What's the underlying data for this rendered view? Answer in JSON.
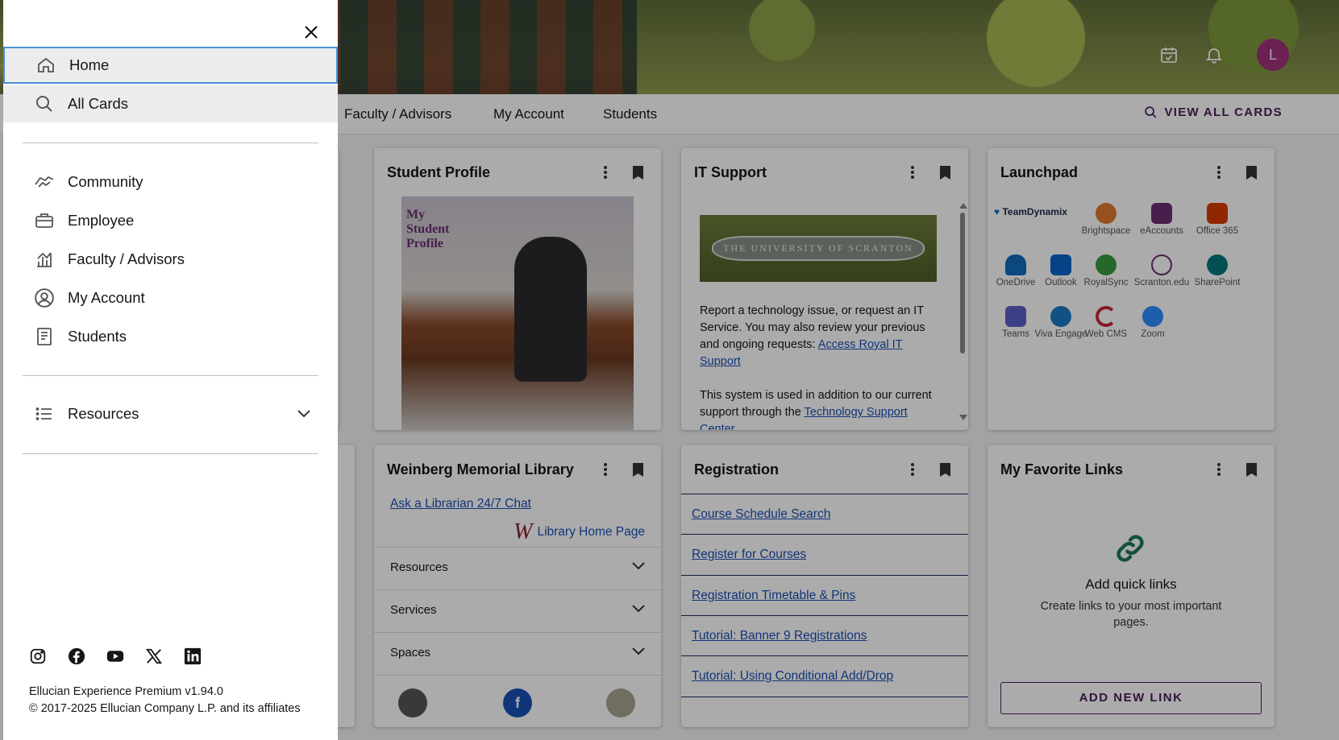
{
  "header": {
    "avatar_initial": "L"
  },
  "navbar": {
    "links": [
      "Faculty / Advisors",
      "My Account",
      "Students"
    ],
    "view_all": "VIEW ALL CARDS"
  },
  "cards": {
    "student_profile": {
      "title": "Student Profile",
      "image_text": "My Student Profile"
    },
    "it_support": {
      "title": "IT Support",
      "banner_text": "THE UNIVERSITY OF SCRANTON",
      "para1_text": "Report a technology issue, or request an IT Service. You may also review your previous and ongoing requests: ",
      "para1_link": "Access Royal IT Support",
      "para2_text": "This system is used in addition to our current support through the ",
      "para2_link": "Technology Support Center"
    },
    "launchpad": {
      "title": "Launchpad",
      "items": [
        "TeamDynamix",
        "Brightspace",
        "eAccounts",
        "Office 365",
        "OneDrive",
        "Outlook",
        "RoyalSync",
        "Scranton.edu",
        "SharePoint",
        "Teams",
        "Viva Engage",
        "Web CMS",
        "Zoom"
      ]
    },
    "library": {
      "title": "Weinberg Memorial Library",
      "chat_link": "Ask a Librarian 24/7 Chat",
      "home_link": "Library Home Page",
      "sections": [
        "Resources",
        "Services",
        "Spaces"
      ]
    },
    "registration": {
      "title": "Registration",
      "links": [
        "Course Schedule Search",
        "Register for Courses",
        "Registration Timetable & Pins",
        "Tutorial: Banner 9 Registrations",
        "Tutorial: Using Conditional Add/Drop"
      ]
    },
    "favorites": {
      "title": "My Favorite Links",
      "heading": "Add quick links",
      "desc": "Create links to your most important pages.",
      "button": "ADD NEW LINK"
    }
  },
  "drawer": {
    "items": {
      "home": "Home",
      "all_cards": "All Cards",
      "community": "Community",
      "employee": "Employee",
      "faculty": "Faculty / Advisors",
      "account": "My Account",
      "students": "Students",
      "resources": "Resources"
    },
    "footer": {
      "version": "Ellucian Experience Premium v1.94.0",
      "copyright": "© 2017-2025 Ellucian Company L.P. and its affiliates"
    }
  },
  "colors": {
    "brand_purple": "#4b1b5c",
    "avatar": "#a0327a",
    "link_blue": "#1a4fb5",
    "focus_outline": "#4a90d9"
  }
}
